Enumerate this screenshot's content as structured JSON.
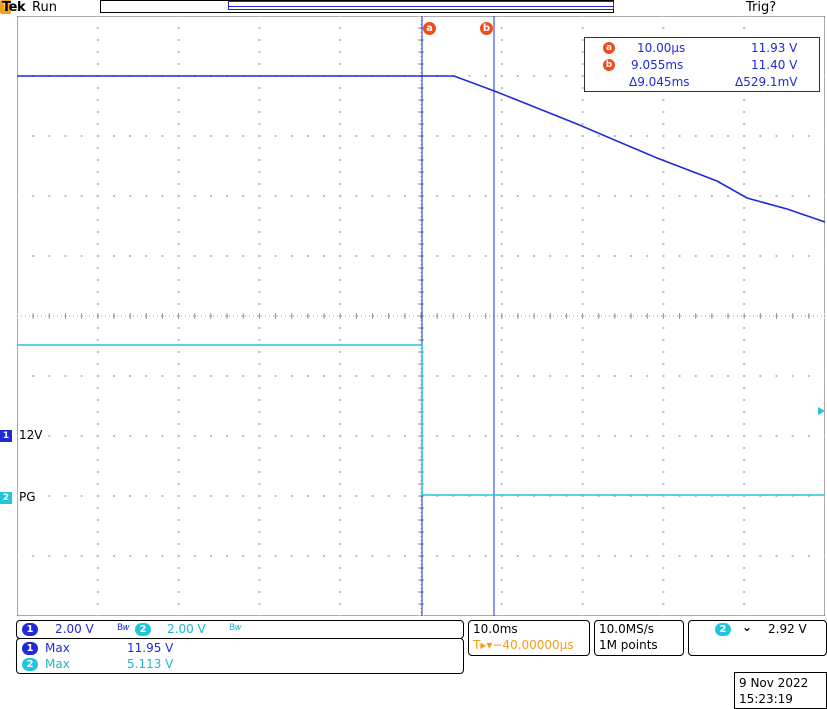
{
  "header": {
    "brand": "Tek",
    "acq_state": "Run",
    "trigger_status": "Trig?"
  },
  "cursors": {
    "marker_a": "a",
    "marker_b": "b",
    "trigger_marker": "T",
    "a_time": "10.00µs",
    "a_volt": "11.93 V",
    "b_time": "9.055ms",
    "b_volt": "11.40 V",
    "delta_time": "Δ9.045ms",
    "delta_volt": "Δ529.1mV"
  },
  "channels": {
    "ch1": {
      "num": "1",
      "label": "12V",
      "color": "#1f2bd6",
      "scale": "2.00 V",
      "coupling": "B𝑤"
    },
    "ch2": {
      "num": "2",
      "label": "PG",
      "color": "#22c6dc",
      "scale": "2.00 V",
      "coupling": "B𝑤"
    }
  },
  "measurements": [
    {
      "ch": "1",
      "name": "Max",
      "value": "11.95 V"
    },
    {
      "ch": "2",
      "name": "Max",
      "value": "5.113 V"
    }
  ],
  "timebase": {
    "scale": "10.0ms",
    "position": "T▸▾−40.00000µs",
    "sample_rate": "10.0MS/s",
    "record_length": "1M points"
  },
  "trigger": {
    "source": "2",
    "slope_icon": "falling-edge-icon",
    "slope_glyph": "⌄",
    "level": "2.92 V"
  },
  "datetime": {
    "date": "9 Nov 2022",
    "time": "15:23:19"
  }
}
